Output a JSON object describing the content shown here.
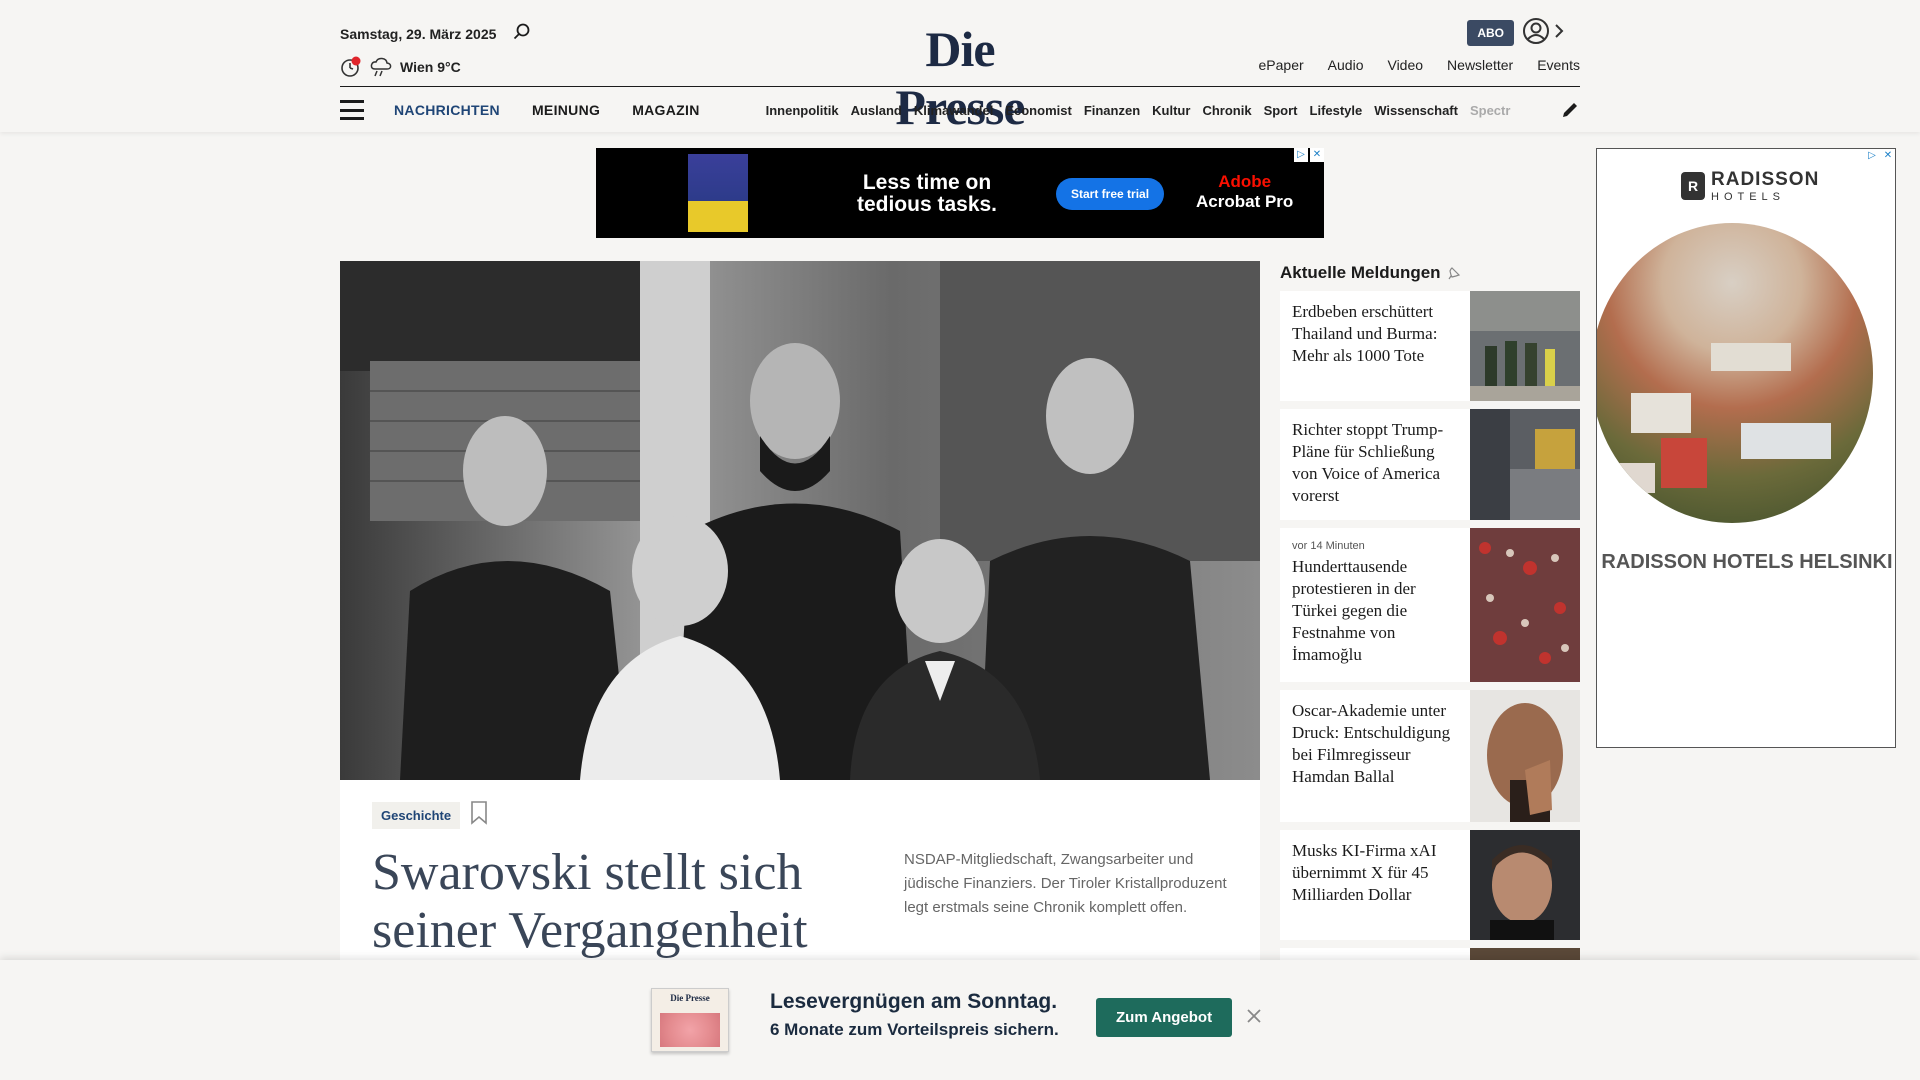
{
  "header": {
    "date": "Samstag, 29. März 2025",
    "weather": "Wien 9°C",
    "logo": "Die Presse",
    "abo": "ABO",
    "sub_links": [
      "ePaper",
      "Audio",
      "Video",
      "Newsletter",
      "Events"
    ],
    "main_nav": [
      "NACHRICHTEN",
      "MEINUNG",
      "MAGAZIN"
    ],
    "section_nav": [
      "Innenpolitik",
      "Ausland",
      "Klimawandel",
      "Economist",
      "Finanzen",
      "Kultur",
      "Chronik",
      "Sport",
      "Lifestyle",
      "Wissenschaft",
      "Spectr"
    ]
  },
  "ad_top": {
    "headline": "Less time on tedious tasks.",
    "cta": "Start free trial",
    "brand_line1": "Adobe",
    "brand_line2": "Acrobat Pro"
  },
  "ad_right": {
    "brand": "RADISSON",
    "brand_sub": "HOTELS",
    "caption": "RADISSON HOTELS HELSINKI"
  },
  "article": {
    "tag": "Geschichte",
    "headline": "Swarovski stellt sich seiner Vergangenheit",
    "teaser": "NSDAP-Mitgliedschaft, Zwangsarbeiter und jüdische Finanziers. Der Tiroler Kristallproduzent legt erstmals seine Chronik komplett offen."
  },
  "sidebar": {
    "title": "Aktuelle Meldungen",
    "items": [
      {
        "ago": "",
        "title": "Erdbeben erschüttert Thailand und Burma: Mehr als 1000 Tote"
      },
      {
        "ago": "",
        "title": "Richter stoppt Trump-Pläne für Schließung von Voice of America vorerst"
      },
      {
        "ago": "vor 14 Minuten",
        "title": "Hunderttausende protestieren in der Türkei gegen die Festnahme von İmamoğlu"
      },
      {
        "ago": "",
        "title": "Oscar-Akademie unter Druck: Entschuldigung bei Filmregisseur Hamdan Ballal"
      },
      {
        "ago": "",
        "title": "Musks KI-Firma xAI übernimmt X für 45 Milliarden Dollar"
      }
    ]
  },
  "promo": {
    "thumb_logo": "Die Presse",
    "line1": "Lesevergnügen am Sonntag.",
    "line2": "6 Monate zum Vorteilspreis sichern.",
    "button": "Zum Angebot"
  },
  "colors": {
    "brand_blue": "#1f4576",
    "abo_bg": "#3b4a63",
    "promo_button": "#1e6b5c",
    "adobe_red": "#fa0f00",
    "ad_cta": "#1473e6"
  }
}
